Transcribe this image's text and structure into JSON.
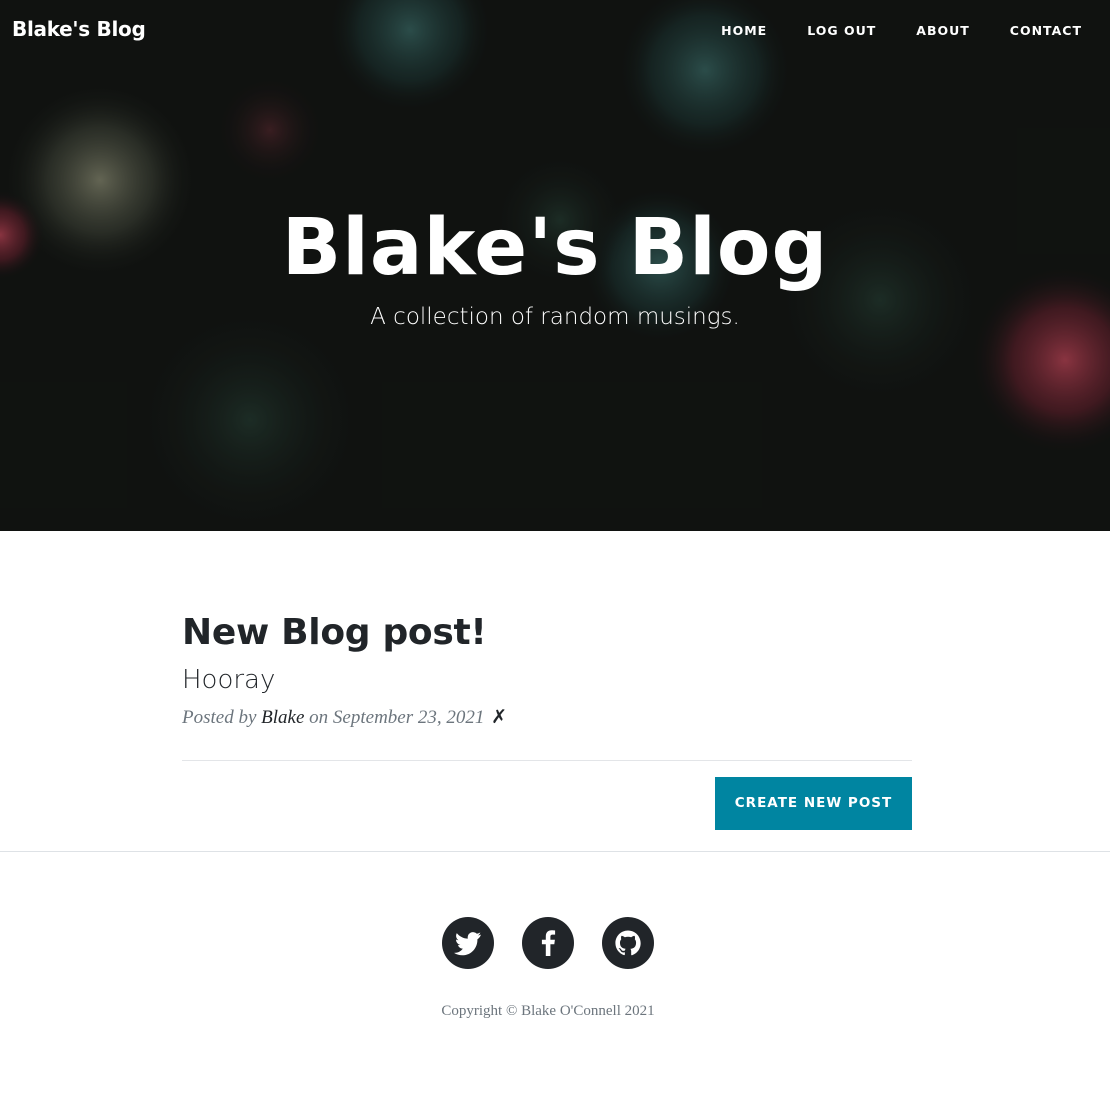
{
  "navbar": {
    "brand": "Blake's Blog",
    "items": [
      {
        "label": "HOME"
      },
      {
        "label": "LOG OUT"
      },
      {
        "label": "ABOUT"
      },
      {
        "label": "CONTACT"
      }
    ]
  },
  "hero": {
    "title": "Blake's Blog",
    "subtitle": "A collection of random musings."
  },
  "posts": [
    {
      "title": "New Blog post!",
      "subtitle": "Hooray",
      "meta_prefix": "Posted by",
      "author": "Blake",
      "meta_date": "on September 23, 2021",
      "delete_icon": "✗"
    }
  ],
  "actions": {
    "create_label": "CREATE NEW POST"
  },
  "footer": {
    "social": [
      {
        "icon": "twitter-icon"
      },
      {
        "icon": "facebook-icon"
      },
      {
        "icon": "github-icon"
      }
    ],
    "copyright": "Copyright © Blake O'Connell 2021"
  },
  "colors": {
    "accent": "#0085a1",
    "text": "#212529",
    "muted": "#6c757d"
  }
}
